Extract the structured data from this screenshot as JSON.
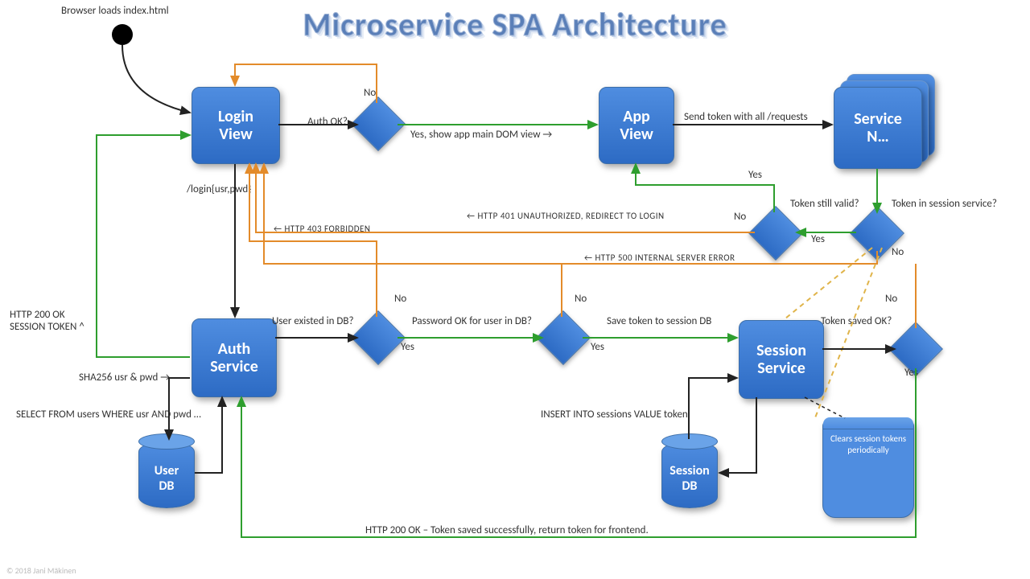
{
  "title": "Microservice SPA Architecture",
  "start_label": "Browser loads index.html",
  "nodes": {
    "login_view": "Login\nView",
    "app_view": "App\nView",
    "service_n": "Service\nN…",
    "auth_service": "Auth\nService",
    "session_service": "Session\nService",
    "user_db": "User\nDB",
    "session_db": "Session\nDB"
  },
  "scroll_note": "Clears session tokens periodically",
  "decisions": {
    "auth_ok": "Auth OK?",
    "user_existed": "User existed in DB?",
    "pwd_ok": "Password OK for user in DB?",
    "token_saved": "Token saved OK?",
    "token_valid": "Token still valid?",
    "token_in_session": "Token in session service?"
  },
  "edge_labels": {
    "no": "No",
    "yes": "Yes",
    "yes_show_main": "Yes, show app main DOM view  →",
    "send_token": "Send token with all /requests",
    "login_call": "/login{usr,pwd}",
    "http403": "←  HTTP 403 FORBIDDEN",
    "http401": "←  HTTP 401 UNAUTHORIZED,  REDIRECT TO LOGIN",
    "http500": "←  HTTP 500 INTERNAL  SERVER  ERROR",
    "save_token": "Save token to session DB",
    "insert_sessions": "INSERT INTO sessions VALUE token",
    "select_users": "SELECT FROM users WHERE usr AND pwd …",
    "sha256": "SHA256 usr & pwd →",
    "http200_token": "HTTP 200 OK\nSESSION TOKEN ^",
    "http200_saved": "HTTP 200  OK – Token saved successfully, return token for frontend."
  },
  "colors": {
    "green": "#2e9e2e",
    "orange": "#e38b2a",
    "black": "#222",
    "dashed": "#e0b44a"
  },
  "footer": "© 2018  Jani Mäkinen"
}
